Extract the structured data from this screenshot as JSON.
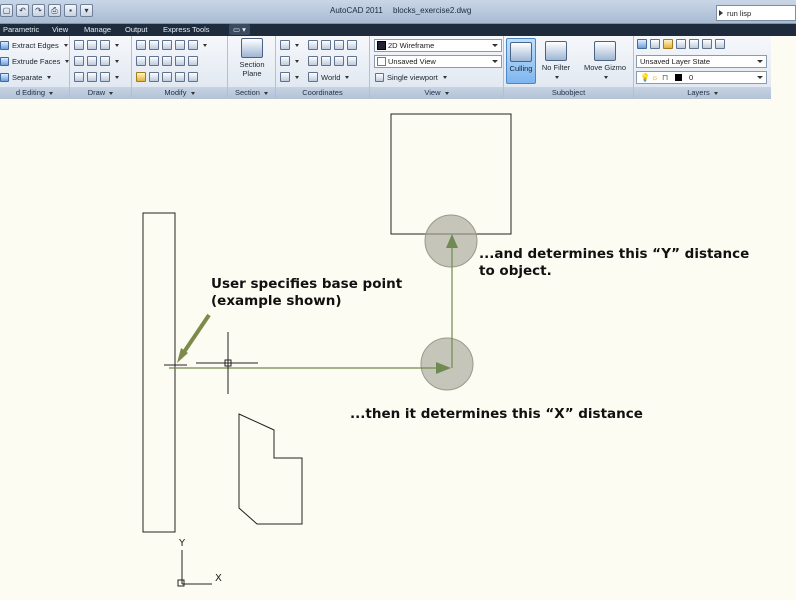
{
  "titlebar": {
    "app_name": "AutoCAD 2011",
    "file_name": "blocks_exercise2.dwg",
    "search_value": "run lisp"
  },
  "tabs": [
    "Parametric",
    "View",
    "Manage",
    "Output",
    "Express Tools"
  ],
  "panels": {
    "solid_editing": {
      "title": "d Editing",
      "items": [
        "Extract Edges",
        "Extrude Faces",
        "Separate"
      ]
    },
    "draw": {
      "title": "Draw"
    },
    "modify": {
      "title": "Modify"
    },
    "section": {
      "title": "Section",
      "button_label": "Section\nPlane"
    },
    "coordinates": {
      "title": "Coordinates",
      "ucs_value": "World"
    },
    "view": {
      "title": "View",
      "visual_style": "2D Wireframe",
      "named_view": "Unsaved View",
      "viewport": "Single viewport"
    },
    "subobject": {
      "title": "Subobject",
      "culling": "Culling",
      "no_filter": "No Filter",
      "move_gizmo": "Move Gizmo"
    },
    "layers": {
      "title": "Layers",
      "layer_state": "Unsaved Layer State",
      "current_layer": "0"
    }
  },
  "drawing": {
    "annotation_base": "User specifies base point\n(example shown)",
    "annotation_y": "...and determines this “Y” distance\nto object.",
    "annotation_x": "...then it determines this “X” distance",
    "ucs_x": "X",
    "ucs_y": "Y"
  },
  "colors": {
    "arrow_green": "#6f8a52",
    "marker_fill": "#a9a89b",
    "pointer_olive": "#7d8b4a",
    "canvas_bg": "#fdfcf2"
  }
}
